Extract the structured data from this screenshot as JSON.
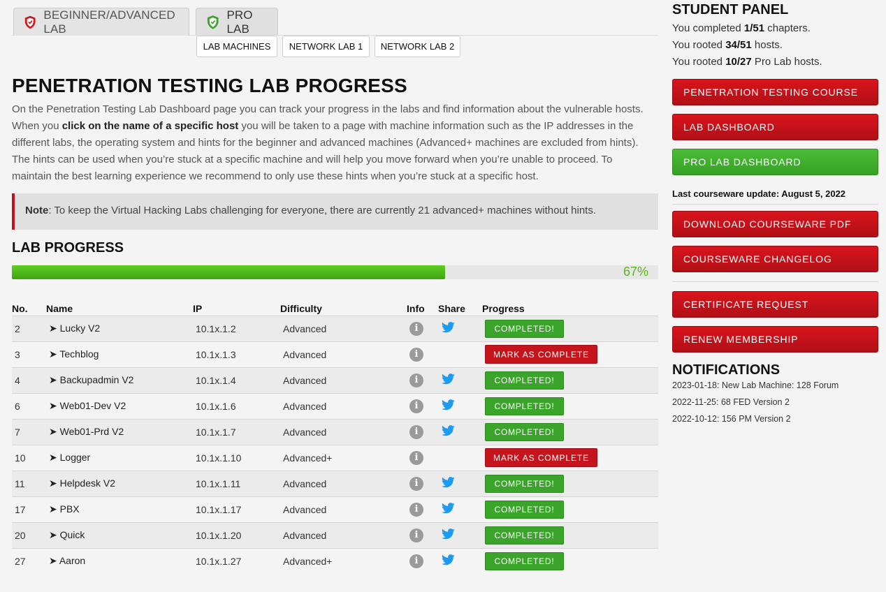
{
  "tabs": [
    {
      "label": "BEGINNER/ADVANCED LAB"
    },
    {
      "label": "PRO LAB"
    }
  ],
  "subtabs": [
    "LAB MACHINES",
    "NETWORK LAB 1",
    "NETWORK LAB 2"
  ],
  "page_title": "PENETRATION TESTING LAB PROGRESS",
  "intro": {
    "part1": "On the Penetration Testing Lab Dashboard page you can track your progress in the labs and find information about the vulnerable hosts. When you ",
    "bold": "click on the name of a specific host",
    "part2": " you will be taken to a page with machine information such as the IP addresses in the different labs, the operating system and hints for the beginner and advanced machines (Advanced+ machines are excluded from hints). The hints can be used when you’re stuck at a specific machine and will help you move forward when you’re unable to proceed. To maintain the best learning experience we recommend to only use these hints when you’re stuck at a specific host."
  },
  "note": {
    "label": "Note",
    "text": ": To keep the Virtual Hacking Labs challenging for everyone, there are currently 21 advanced+ machines without hints."
  },
  "lab_progress": {
    "title": "LAB PROGRESS",
    "percent_label": "67%",
    "fraction": 0.67
  },
  "table": {
    "headers": [
      "No.",
      "Name",
      "IP",
      "Difficulty",
      "Info",
      "Share",
      "Progress"
    ],
    "rows": [
      {
        "no": "2",
        "name": "➤ Lucky V2",
        "ip": "10.1x.1.2",
        "difficulty": "Advanced",
        "status": "COMPLETED!",
        "shared": true
      },
      {
        "no": "3",
        "name": "➤ Techblog",
        "ip": "10.1x.1.3",
        "difficulty": "Advanced",
        "status": "MARK AS COMPLETE",
        "shared": false
      },
      {
        "no": "4",
        "name": "➤ Backupadmin V2",
        "ip": "10.1x.1.4",
        "difficulty": "Advanced",
        "status": "COMPLETED!",
        "shared": true
      },
      {
        "no": "6",
        "name": "➤ Web01-Dev V2",
        "ip": "10.1x.1.6",
        "difficulty": "Advanced",
        "status": "COMPLETED!",
        "shared": true
      },
      {
        "no": "7",
        "name": "➤ Web01-Prd V2",
        "ip": "10.1x.1.7",
        "difficulty": "Advanced",
        "status": "COMPLETED!",
        "shared": true
      },
      {
        "no": "10",
        "name": "➤ Logger",
        "ip": "10.1x.1.10",
        "difficulty": "Advanced+",
        "status": "MARK AS COMPLETE",
        "shared": false
      },
      {
        "no": "11",
        "name": "➤ Helpdesk V2",
        "ip": "10.1x.1.11",
        "difficulty": "Advanced",
        "status": "COMPLETED!",
        "shared": true
      },
      {
        "no": "17",
        "name": "➤ PBX",
        "ip": "10.1x.1.17",
        "difficulty": "Advanced",
        "status": "COMPLETED!",
        "shared": true
      },
      {
        "no": "20",
        "name": "➤ Quick",
        "ip": "10.1x.1.20",
        "difficulty": "Advanced",
        "status": "COMPLETED!",
        "shared": true
      },
      {
        "no": "27",
        "name": "➤ Aaron",
        "ip": "10.1x.1.27",
        "difficulty": "Advanced+",
        "status": "COMPLETED!",
        "shared": true
      }
    ]
  },
  "sidebar": {
    "title": "STUDENT PANEL",
    "stats": [
      {
        "pre": "You completed ",
        "value": "1/51",
        "post": " chapters."
      },
      {
        "pre": "You rooted ",
        "value": "34/51",
        "post": " hosts."
      },
      {
        "pre": "You rooted ",
        "value": "10/27",
        "post": " Pro Lab hosts."
      }
    ],
    "buttons_top": [
      {
        "label": "PENETRATION TESTING COURSE",
        "color": "red"
      },
      {
        "label": "LAB DASHBOARD",
        "color": "red"
      },
      {
        "label": "PRO LAB DASHBOARD",
        "color": "green"
      }
    ],
    "update": "Last courseware update: August 5, 2022",
    "buttons_mid": [
      {
        "label": "DOWNLOAD COURSEWARE PDF"
      },
      {
        "label": "COURSEWARE CHANGELOG"
      }
    ],
    "buttons_bottom": [
      {
        "label": "CERTIFICATE REQUEST"
      },
      {
        "label": "RENEW MEMBERSHIP"
      }
    ],
    "notifications_title": "NOTIFICATIONS",
    "notifications": [
      "2023-01-18: New Lab Machine: 128 Forum",
      "2022-11-25: 68 FED Version 2",
      "2022-10-12: 156 PM Version 2"
    ]
  },
  "colors": {
    "brand_red": "#c5141c",
    "success_green": "#3aa52a",
    "progress_green": "#58b81a",
    "twitter_blue": "#1d9bf0"
  },
  "icons": {
    "info": "info-circle-icon",
    "share": "twitter-icon",
    "tab_beginner": "red-shield-icon",
    "tab_pro": "green-shield-icon"
  }
}
